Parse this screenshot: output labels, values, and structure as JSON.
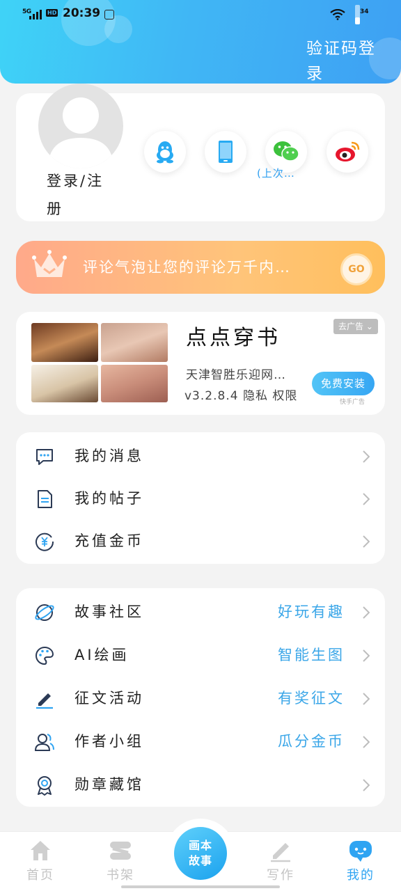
{
  "status_bar": {
    "network": "5G",
    "hd": "HD",
    "time": "20:39",
    "battery": "34"
  },
  "header": {
    "login_link": "验证码登录"
  },
  "profile": {
    "login_register": "登录/注册",
    "social": [
      "qq-icon",
      "phone-icon",
      "wechat-icon",
      "weibo-icon"
    ],
    "last_used_tip": "(上次…"
  },
  "vip_banner": {
    "text": "评论气泡让您的评论万千内…",
    "go_label": "GO"
  },
  "ad": {
    "title": "点点穿书",
    "description": "天津智胜乐迎网…",
    "version_info": "v3.2.8.4 隐私 权限",
    "tag": "去广告",
    "install_label": "免费安装",
    "source": "快手广告"
  },
  "menu_primary": [
    {
      "label": "我的消息",
      "icon": "message-icon"
    },
    {
      "label": "我的帖子",
      "icon": "document-icon"
    },
    {
      "label": "充值金币",
      "icon": "coin-icon"
    }
  ],
  "menu_secondary": [
    {
      "label": "故事社区",
      "value": "好玩有趣",
      "icon": "planet-icon"
    },
    {
      "label": "AI绘画",
      "value": "智能生图",
      "icon": "palette-icon"
    },
    {
      "label": "征文活动",
      "value": "有奖征文",
      "icon": "pen-icon"
    },
    {
      "label": "作者小组",
      "value": "瓜分金币",
      "icon": "group-icon"
    },
    {
      "label": "勋章藏馆",
      "value": "",
      "icon": "medal-icon"
    }
  ],
  "bottom_nav": {
    "items": [
      {
        "label": "首页",
        "icon": "home-icon"
      },
      {
        "label": "书架",
        "icon": "bookshelf-icon"
      },
      {
        "label": "写作",
        "icon": "write-icon"
      },
      {
        "label": "我的",
        "icon": "profile-icon"
      }
    ],
    "active": "我的",
    "center_label_1": "画本",
    "center_label_2": "故事"
  },
  "colors": {
    "accent": "#2fa4f2",
    "header_start": "#3fd3f7",
    "header_end": "#3ea0f3",
    "vip_start": "#ffa98a",
    "vip_end": "#ffbf5c"
  }
}
